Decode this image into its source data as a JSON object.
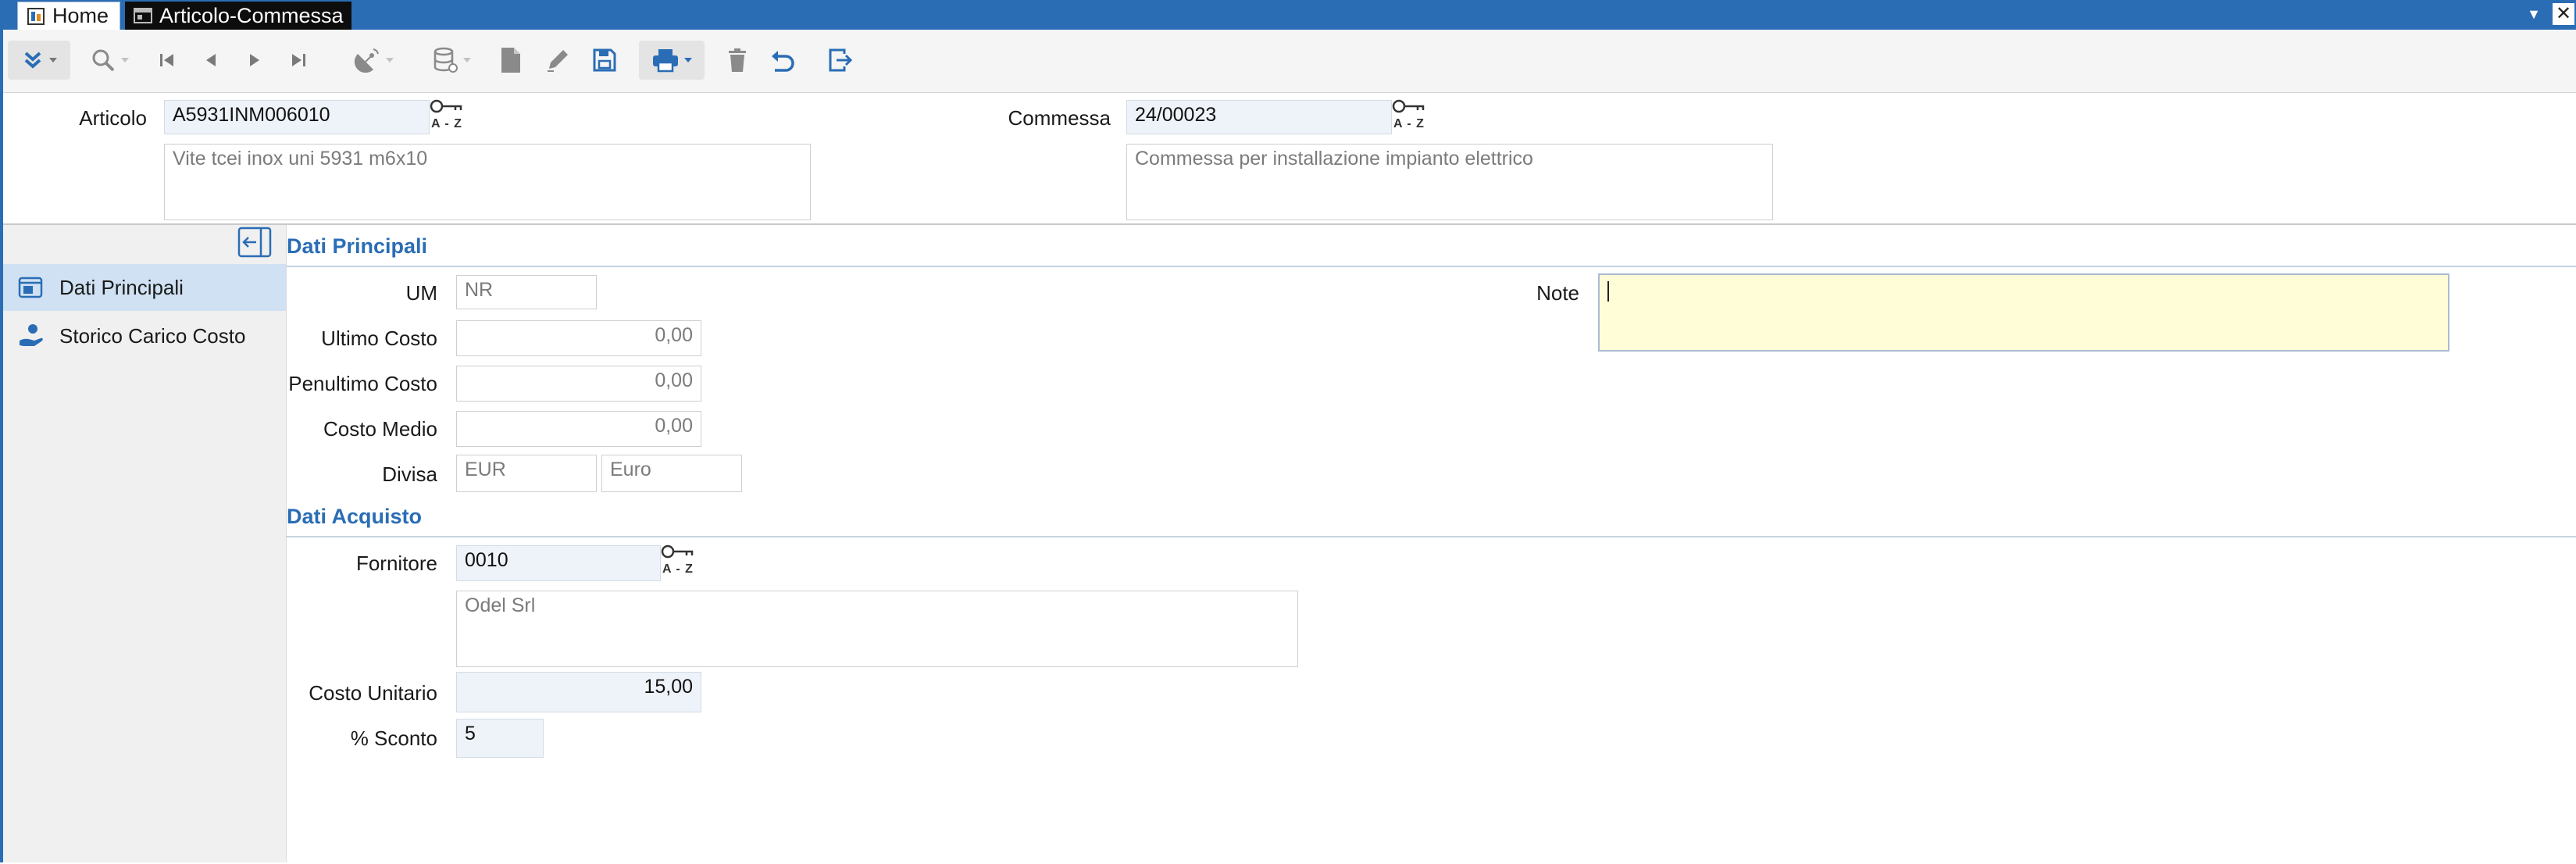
{
  "tabs": [
    {
      "label": "Home",
      "icon": "home-icon"
    },
    {
      "label": "Articolo-Commessa",
      "icon": "window-icon"
    }
  ],
  "toolbar": {
    "icons": [
      "expand-more-icon",
      "search-icon",
      "first-record-icon",
      "previous-record-icon",
      "next-record-icon",
      "last-record-icon",
      "satellite-dish-icon",
      "database-icon",
      "new-document-icon",
      "edit-icon",
      "save-icon",
      "print-icon",
      "delete-icon",
      "undo-icon",
      "exit-icon"
    ]
  },
  "header": {
    "articolo_label": "Articolo",
    "articolo_code": "A5931INM006010",
    "articolo_desc": "Vite tcei inox uni 5931 m6x10",
    "commessa_label": "Commessa",
    "commessa_code": "24/00023",
    "commessa_desc": "Commessa per installazione impianto elettrico",
    "lookup_text": "A - Z"
  },
  "sidebar": {
    "items": [
      {
        "label": "Dati Principali",
        "icon": "product-card-icon",
        "active": true
      },
      {
        "label": "Storico Carico Costo",
        "icon": "hand-coins-icon",
        "active": false
      }
    ]
  },
  "dati_principali": {
    "title": "Dati Principali",
    "um_label": "UM",
    "um_value": "NR",
    "ultimo_costo_label": "Ultimo Costo",
    "ultimo_costo_value": "0,00",
    "penultimo_costo_label": "Penultimo Costo",
    "penultimo_costo_value": "0,00",
    "costo_medio_label": "Costo Medio",
    "costo_medio_value": "0,00",
    "divisa_label": "Divisa",
    "divisa_code": "EUR",
    "divisa_desc": "Euro",
    "note_label": "Note",
    "note_value": ""
  },
  "dati_acquisto": {
    "title": "Dati Acquisto",
    "fornitore_label": "Fornitore",
    "fornitore_code": "0010",
    "fornitore_desc": "Odel Srl",
    "costo_unitario_label": "Costo Unitario",
    "costo_unitario_value": "15,00",
    "sconto_label": "% Sconto",
    "sconto_value": "5"
  },
  "colors": {
    "accent": "#2a6db5",
    "key_field_bg": "#eef3f9",
    "note_bg": "#fffcd8",
    "sidebar_active": "#cfe1f2"
  }
}
